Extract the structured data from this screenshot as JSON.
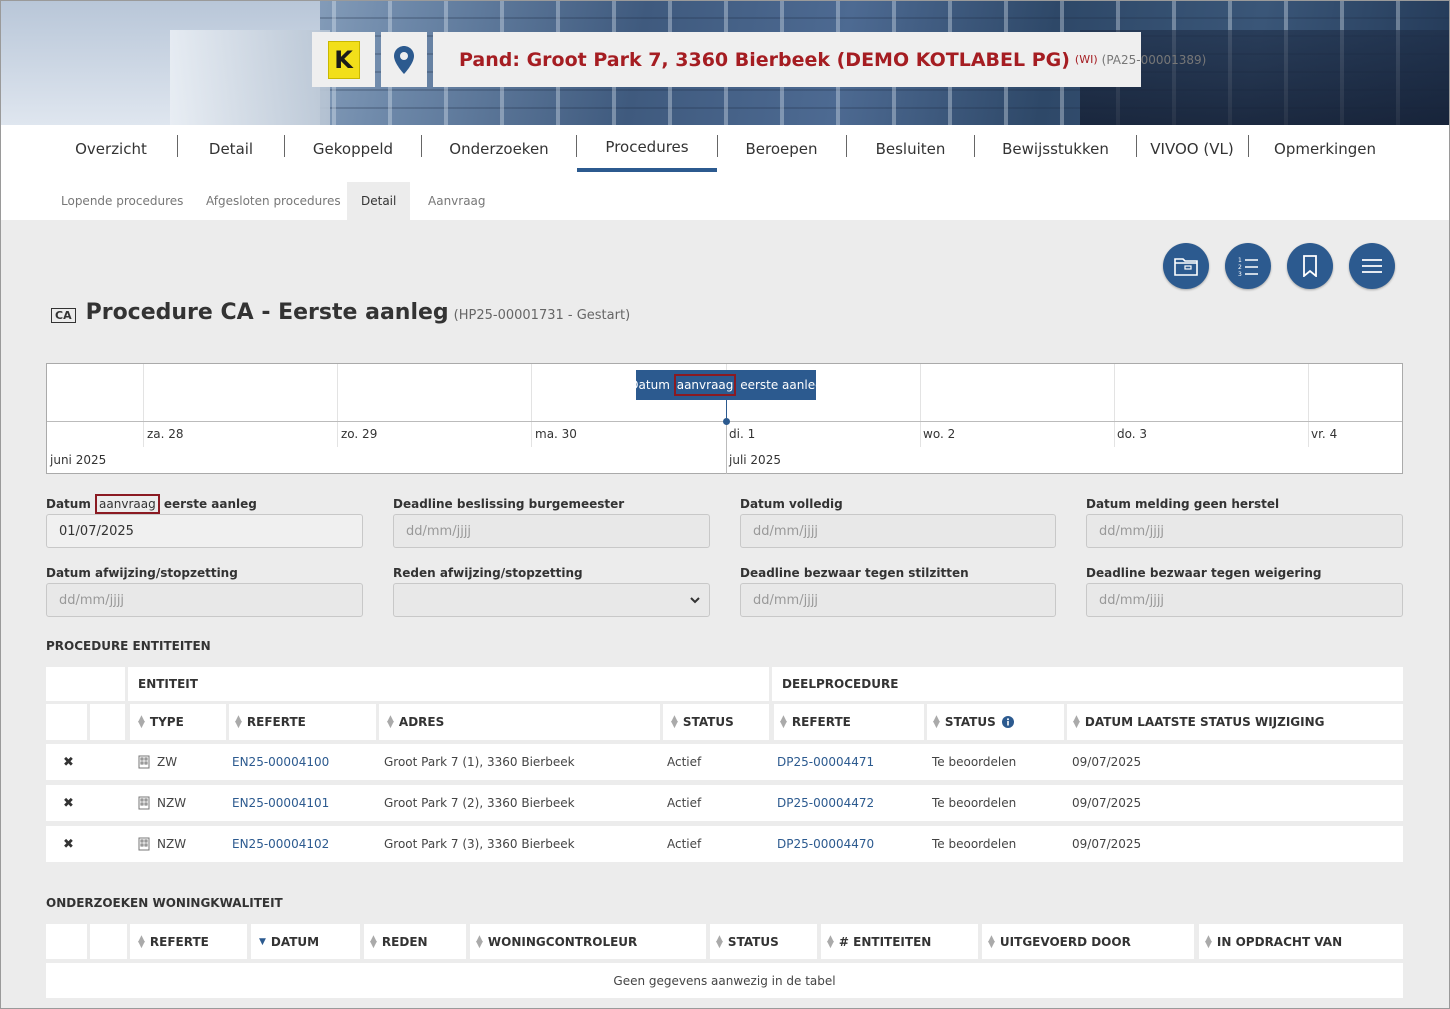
{
  "header": {
    "title": "Pand: Groot Park 7, 3360 Bierbeek (DEMO KOTLABEL PG)",
    "badge": "(WI)",
    "reference": "(PA25-00001389)",
    "logo_letter": "K",
    "icons": [
      "location-pin-icon",
      "cube-icon"
    ]
  },
  "main_tabs": [
    "Overzicht",
    "Detail",
    "Gekoppeld",
    "Onderzoeken",
    "Procedures",
    "Beroepen",
    "Besluiten",
    "Bewijsstukken",
    "VIVOO (VL)",
    "Opmerkingen"
  ],
  "active_main_tab": "Procedures",
  "sub_tabs": [
    "Lopende procedures",
    "Afgesloten procedures",
    "Detail",
    "Aanvraag"
  ],
  "active_sub_tab": "Detail",
  "action_buttons": [
    "folder-icon",
    "numbered-list-icon",
    "bookmark-icon",
    "menu-icon"
  ],
  "procedure": {
    "badge": "CA",
    "title": "Procedure CA - Eerste aanleg",
    "subtitle": "(HP25-00001731 - Gestart)"
  },
  "timeline": {
    "item": {
      "pre": "Datum ",
      "highlight": "aanvraag",
      "post": " eerste aanleg"
    },
    "days": [
      "za. 28",
      "zo. 29",
      "ma. 30",
      "di. 1",
      "wo. 2",
      "do. 3",
      "vr. 4"
    ],
    "months": [
      "juni 2025",
      "juli 2025"
    ]
  },
  "form": {
    "datum_aanvraag": {
      "label_pre": "Datum ",
      "label_highlight": "aanvraag",
      "label_post": " eerste aanleg",
      "value": "01/07/2025"
    },
    "deadline_beslissing": {
      "label": "Deadline beslissing burgemeester",
      "placeholder": "dd/mm/jjjj"
    },
    "datum_volledig": {
      "label": "Datum volledig",
      "placeholder": "dd/mm/jjjj"
    },
    "datum_melding": {
      "label": "Datum melding geen herstel",
      "placeholder": "dd/mm/jjjj"
    },
    "datum_afwijzing": {
      "label": "Datum afwijzing/stopzetting",
      "placeholder": "dd/mm/jjjj"
    },
    "reden_afwijzing": {
      "label": "Reden afwijzing/stopzetting",
      "value": ""
    },
    "deadline_stilzitten": {
      "label": "Deadline bezwaar tegen stilzitten",
      "placeholder": "dd/mm/jjjj"
    },
    "deadline_weigering": {
      "label": "Deadline bezwaar tegen weigering",
      "placeholder": "dd/mm/jjjj"
    }
  },
  "entiteiten": {
    "section_title": "PROCEDURE ENTITEITEN",
    "group_entiteit": "ENTITEIT",
    "group_deelprocedure": "DEELPROCEDURE",
    "columns": [
      "TYPE",
      "REFERTE",
      "ADRES",
      "STATUS",
      "REFERTE",
      "STATUS",
      "DATUM LAATSTE STATUS WIJZIGING"
    ],
    "rows": [
      {
        "delete": "✖",
        "type": "ZW",
        "referte": "EN25-00004100",
        "adres": "Groot Park 7 (1), 3360 Bierbeek",
        "status": "Actief",
        "dp_referte": "DP25-00004471",
        "dp_status": "Te beoordelen",
        "datum": "09/07/2025"
      },
      {
        "delete": "✖",
        "type": "NZW",
        "referte": "EN25-00004101",
        "adres": "Groot Park 7 (2), 3360 Bierbeek",
        "status": "Actief",
        "dp_referte": "DP25-00004472",
        "dp_status": "Te beoordelen",
        "datum": "09/07/2025"
      },
      {
        "delete": "✖",
        "type": "NZW",
        "referte": "EN25-00004102",
        "adres": "Groot Park 7 (3), 3360 Bierbeek",
        "status": "Actief",
        "dp_referte": "DP25-00004470",
        "dp_status": "Te beoordelen",
        "datum": "09/07/2025"
      }
    ]
  },
  "onderzoeken": {
    "section_title": "ONDERZOEKEN WONINGKWALITEIT",
    "columns": [
      "REFERTE",
      "DATUM",
      "REDEN",
      "WONINGCONTROLEUR",
      "STATUS",
      "# ENTITEITEN",
      "UITGEVOERD DOOR",
      "IN OPDRACHT VAN"
    ],
    "empty": "Geen gegevens aanwezig in de tabel"
  },
  "colors": {
    "accent": "#2c5a8f",
    "title_red": "#a51d22",
    "highlight_border": "#8b1a22"
  }
}
